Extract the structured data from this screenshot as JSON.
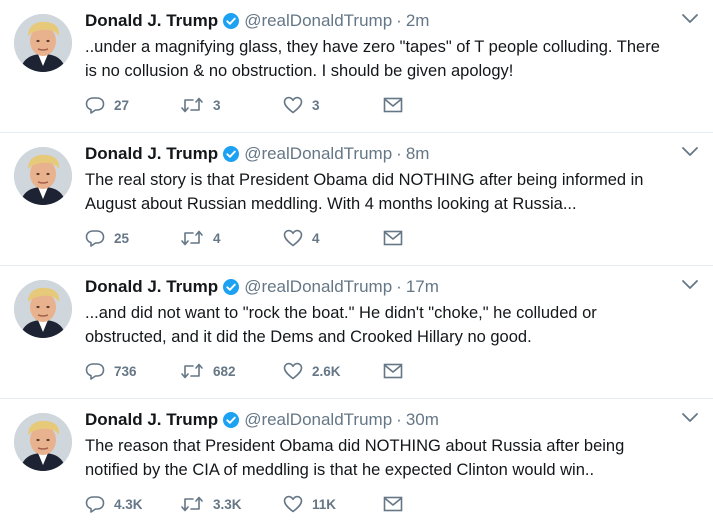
{
  "author": {
    "name": "Donald J. Trump",
    "handle": "@realDonaldTrump"
  },
  "icons": {
    "reply": "reply-icon",
    "retweet": "retweet-icon",
    "like": "heart-icon",
    "dm": "envelope-icon",
    "verified": "verified-badge-icon",
    "caret": "chevron-down-icon"
  },
  "colors": {
    "icon": "#657786",
    "verified": "#1da1f2",
    "divider": "#e6ecf0"
  },
  "tweets": [
    {
      "time": "2m",
      "text_lines": [
        "..under a magnifying glass, they have zero \"tapes\" of T people colluding. There",
        "is no collusion & no obstruction. I should be given apology!"
      ],
      "replies": "27",
      "retweets": "3",
      "likes": "3"
    },
    {
      "time": "8m",
      "text_lines": [
        "The real story is that President Obama did NOTHING after being informed in",
        "August about Russian meddling. With 4 months looking at Russia..."
      ],
      "replies": "25",
      "retweets": "4",
      "likes": "4"
    },
    {
      "time": "17m",
      "text_lines": [
        "...and did not want to \"rock the boat.\" He didn't \"choke,\" he colluded or",
        "obstructed, and it did the Dems and Crooked Hillary no good."
      ],
      "replies": "736",
      "retweets": "682",
      "likes": "2.6K"
    },
    {
      "time": "30m",
      "text_lines": [
        "The reason that President Obama did NOTHING about Russia after being",
        "notified by the CIA of meddling is that he expected Clinton would win.."
      ],
      "replies": "4.3K",
      "retweets": "3.3K",
      "likes": "11K"
    }
  ]
}
